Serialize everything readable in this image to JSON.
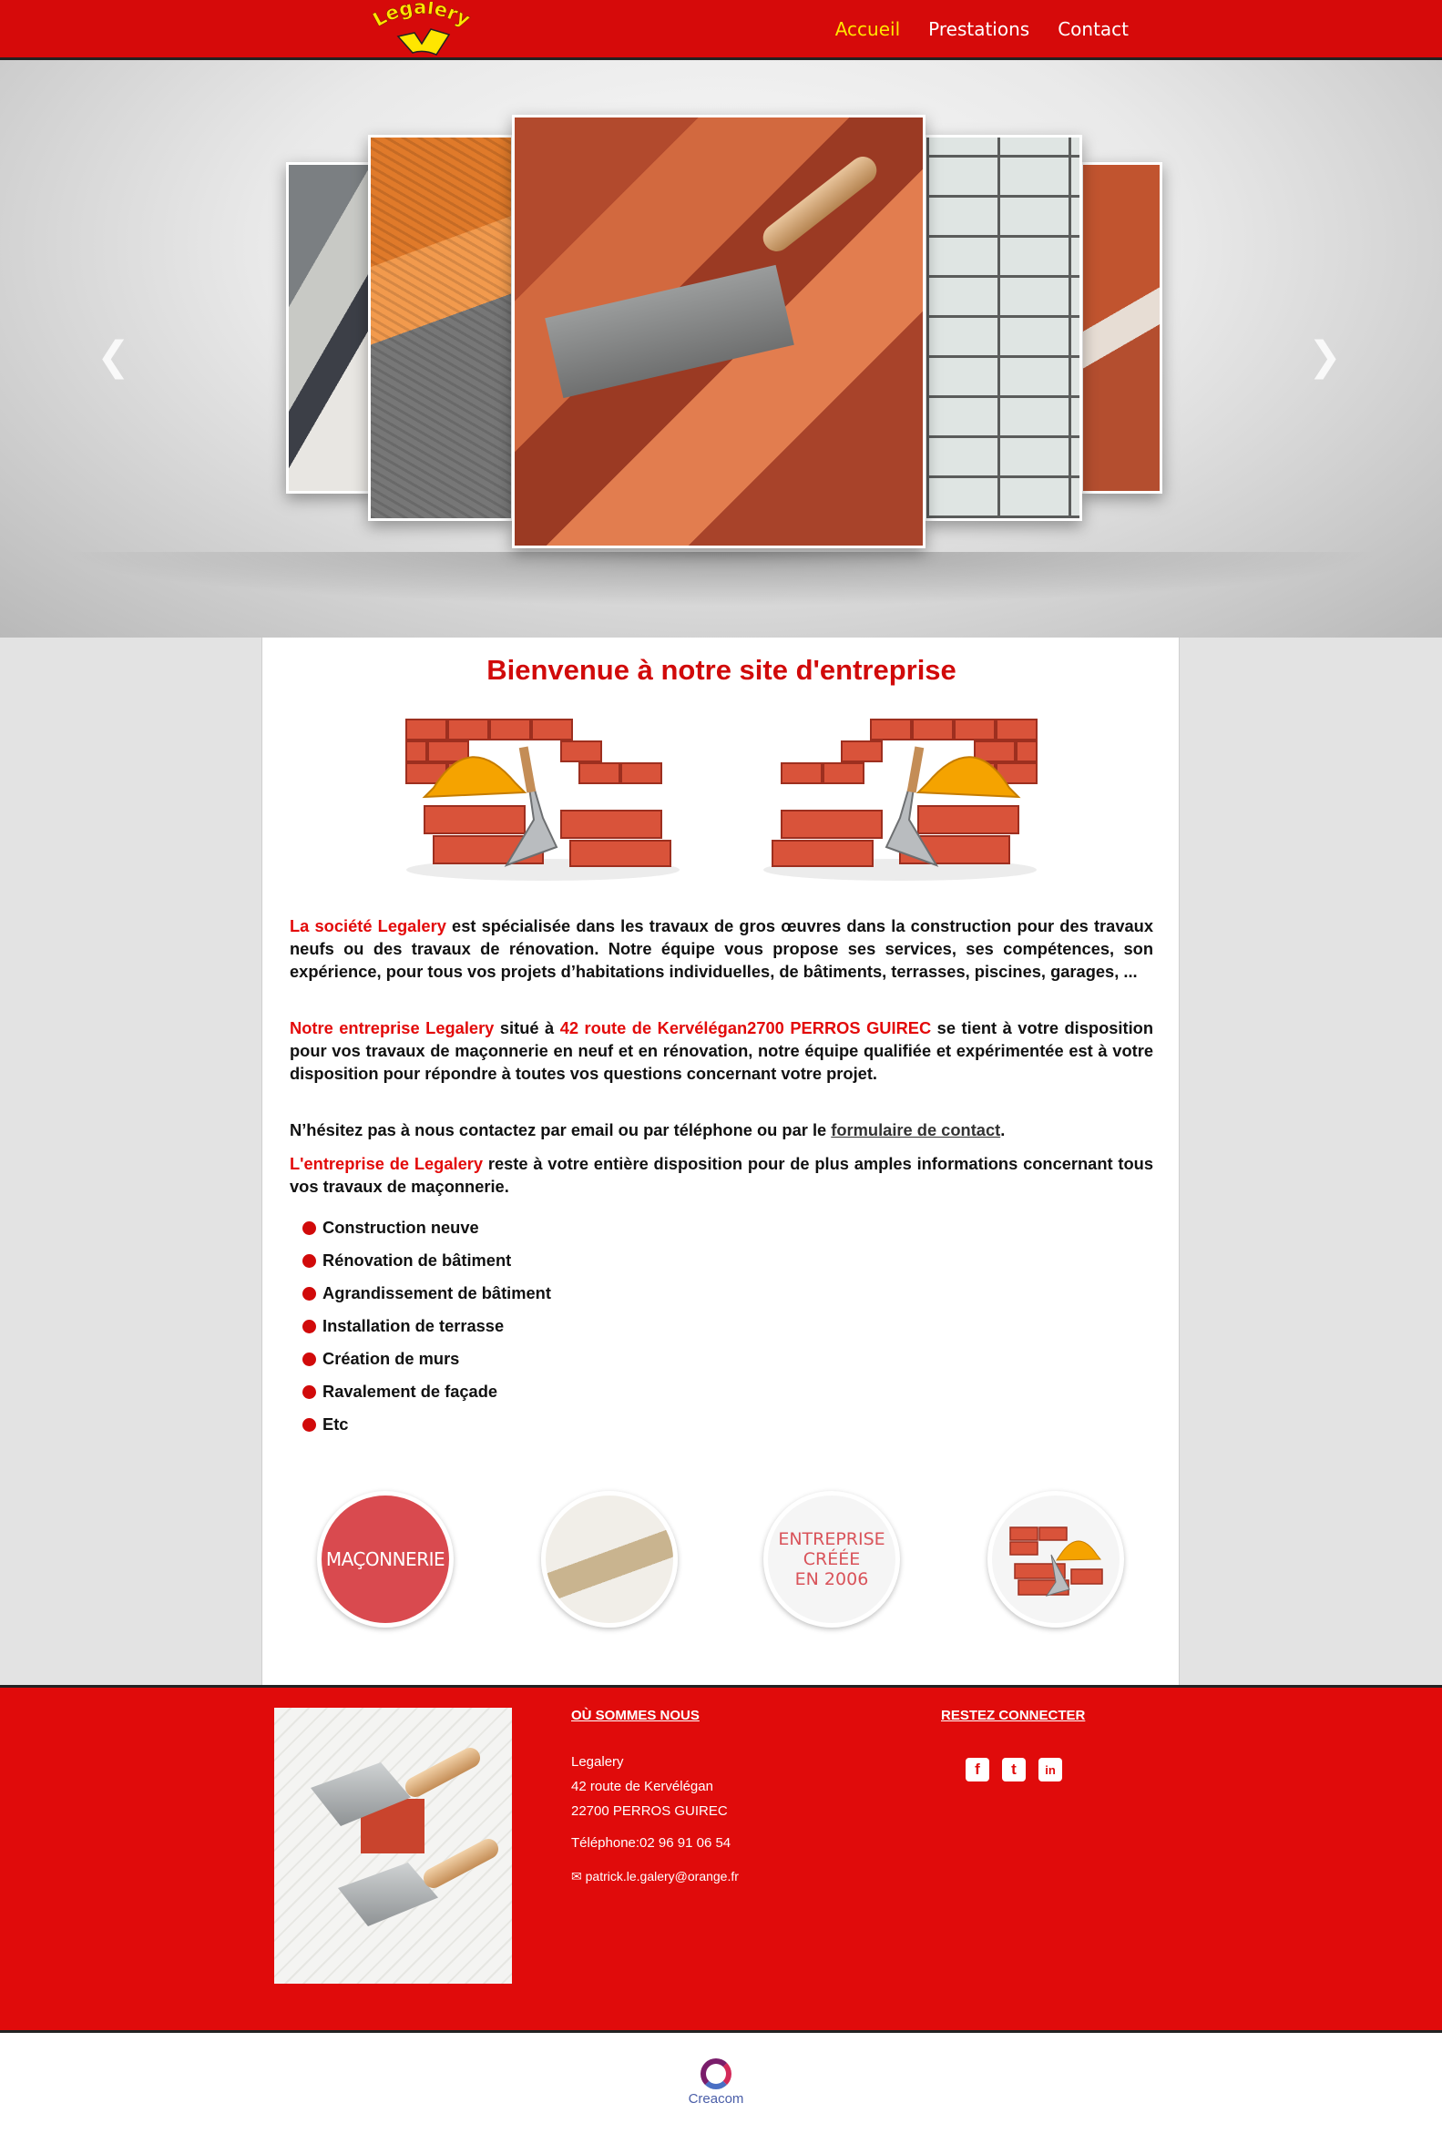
{
  "header": {
    "logo_text": "Legalery",
    "nav": [
      {
        "label": "Accueil",
        "active": true
      },
      {
        "label": "Prestations",
        "active": false
      },
      {
        "label": "Contact",
        "active": false
      }
    ]
  },
  "slider": {
    "prev_icon": "chevron-left-icon",
    "next_icon": "chevron-right-icon",
    "prev_glyph": "❮",
    "next_glyph": "❯"
  },
  "main": {
    "title": "Bienvenue à notre site d'entreprise",
    "p1_red": "La société Legalery",
    "p1_rest": " est spécialisée dans les travaux de gros œuvres dans la construction pour des travaux neufs ou des travaux de rénovation. Notre équipe vous propose ses services, ses compétences, son expérience, pour tous vos projets d’habitations individuelles, de bâtiments, terrasses, piscines, garages, ...",
    "p2_red": "Notre entreprise Legalery",
    "p2_mid": " situé à ",
    "p2_addr": "42 route de Kervélégan2700 PERROS GUIREC",
    "p2_rest": " se tient à votre disposition pour vos travaux de maçonnerie en neuf et en rénovation, notre équipe qualifiée et expérimentée est à votre disposition pour répondre à toutes vos questions concernant votre projet.",
    "p3_text": "N’hésitez pas à nous contactez par email ou par téléphone ou par le ",
    "p3_link": "formulaire de contact",
    "p3_end": ".",
    "p4_red": "L'entreprise de Legalery",
    "p4_rest": " reste à votre entière disposition pour de plus amples informations concernant tous vos travaux de maçonnerie.",
    "services": [
      "Construction neuve",
      "Rénovation de bâtiment",
      "Agrandissement de bâtiment",
      "Installation de terrasse",
      "Création de murs",
      "Ravalement de façade",
      "Etc"
    ],
    "badges": {
      "b1": "MAÇONNERIE",
      "b3_l1": "ENTREPRISE",
      "b3_l2": "CRÉÉE",
      "b3_l3": "EN 2006"
    }
  },
  "footer": {
    "where_title": "OÙ SOMMES NOUS",
    "company": "Legalery",
    "address1": "42 route de Kervélégan",
    "address2": "22700 PERROS GUIREC",
    "phone": "Téléphone:02 96 91 06 54",
    "email": "patrick.le.galery@orange.fr",
    "social_title": "RESTEZ CONNECTER",
    "social": [
      {
        "icon": "facebook-icon",
        "glyph": "f"
      },
      {
        "icon": "twitter-icon",
        "glyph": "t"
      },
      {
        "icon": "linkedin-icon",
        "glyph": "in"
      }
    ],
    "credit": "Creacom"
  },
  "colors": {
    "brand_red": "#d60a0a",
    "nav_active": "#ffe600",
    "accent_text": "#e30a0a"
  }
}
